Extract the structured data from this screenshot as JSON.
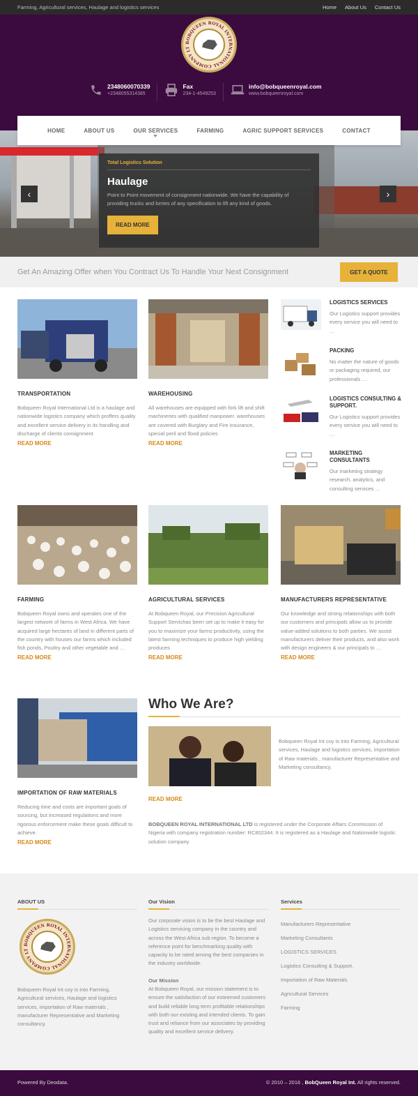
{
  "topbar": {
    "tagline": "Farming, Agricultural services, Haulage and logistics services",
    "links": [
      "Home",
      "About Us",
      "Contact Us"
    ]
  },
  "logo": {
    "ring_text": "BOBQUEEN ROYAL INTERNATIONAL COMPANY LTD"
  },
  "contacts": [
    {
      "icon": "phone-icon",
      "main": "2348060070339",
      "sub": "+2348055314385"
    },
    {
      "icon": "fax-icon",
      "main": "Fax",
      "sub": "234-1-4549253"
    },
    {
      "icon": "laptop-icon",
      "main": "info@bobqueenroyal.com",
      "sub": "www.bobqueenroyal.com"
    }
  ],
  "nav": [
    "HOME",
    "ABOUT US",
    "OUR SERVICES",
    "FARMING",
    "AGRIC SUPPORT SERVICES",
    "CONTACT"
  ],
  "slide": {
    "kicker": "Total Logistics Solution",
    "title": "Haulage",
    "text": "Point to Point movement of consignment nationwide. We have the capability of providing trucks and lorries of any specification to lift any kind of goods.",
    "button": "READ MORE"
  },
  "offer": {
    "text": "Get An Amazing Offer when You Contract Us To Handle Your Next Consignment",
    "button": "GET A QUOTE"
  },
  "services": [
    {
      "title": "TRANSPORTATION",
      "text": "Bobqueen Royal International Ltd is a haulage and nationwide logistics company which proffers quality and excellent service delivery in its handling and discharge of clients consignment",
      "link": "READ MORE"
    },
    {
      "title": "WAREHOUSING",
      "text": "All warehouses are equipped with fork lift and shift machineries with qualified manpower. warehouses are covered with Burglary and Fire insurance, special peril and flood policies",
      "link": "READ MORE"
    },
    {
      "title": "FARMING",
      "text": "Bobqueen Royal owns and operates one of the largest network of farms in West Africa. We have acquired large hectares of land in different parts of the country with houses our farms which included fish ponds, Poultry and other vegetable and …",
      "link": "READ MORE"
    },
    {
      "title": "AGRICULTURAL SERVICES",
      "text": "At Bobqueen Royal, our Precision Agricultural Support Servichas been set up to make it easy for you to maximize your farms productivity, using the latest farming techniques to produce high yielding produces",
      "link": "READ MORE"
    },
    {
      "title": "MANUFACTURERS REPRESENTATIVE",
      "text": "Our knowledge and strong relationships with both our customers and principals allow us to provide value-added solutions to both parties. We assist manufacturers deliver their products, and also work with design engineers & our principals to …",
      "link": "READ MORE"
    },
    {
      "title": "IMPORTATION OF RAW MATERIALS",
      "text": "Reducing time and costs are important goals of sourcing, but increased regulations and more rigorous enforcement make these goals difficult to achieve.",
      "link": "READ MORE"
    }
  ],
  "side_services": [
    {
      "title": "LOGISTICS SERVICES",
      "text": "Our Logistics support provides every service you will need to …"
    },
    {
      "title": "PACKING",
      "text": "No matter the nature of goods or packaging required, our professionals …"
    },
    {
      "title": "LOGISTICS CONSULTING & SUPPORT.",
      "text": "Our Logistics support provides every service you will need to …"
    },
    {
      "title": "MARKETING CONSULTANTS",
      "text": "Our marketing strategy research, analytics, and consulting services …"
    }
  ],
  "who": {
    "title": "Who We Are?",
    "text": "Bobqueen Royal Int coy is into Farming, Agricultural services, Haulage and logistics services, importation of Raw materials , manufacturer Representative and Marketing consultancy.",
    "link": "READ MORE",
    "reg_name": "BOBQUEEN ROYAL INTERNATIONAL LTD",
    "reg_text": " is registered under the Corporate Affairs Commission of Nigeria with company registration number: RC802344. It is registered as a Haulage and Nationwide logistic solution company"
  },
  "footer": {
    "about": {
      "title": "ABOUT US",
      "text": "Bobqueen Royal Int coy is into Farming, Agricultural services, Haulage and logistics services, importation of Raw materials , manufacturer Representative and Marketing consultancy."
    },
    "vision": {
      "title": "Our Vision",
      "text": "Our corporate vision is to be the best Haulage and Logistics servicing company in the country and across the West Africa sub region. To become a reference point for benchmarking quality with capacity to be rated among the best companies in the industry worldwide.",
      "mission_title": "Our Mission",
      "mission_text": "At Bobqueen Royal, our mission statement is to ensure the satisfaction of our esteemed customers and build reliable long term profitable relationships with both our existing and intended clients. To gain trust and reliance from our associates by providing quality and excellent service delivery."
    },
    "services": {
      "title": "Services",
      "links": [
        "Manufacturers Representative",
        "Marketing Consultants",
        "LOGISTICS SERVICES",
        "Logistics Consulting & Support.",
        "Importation of Raw Materials",
        "Agricultural Services",
        "Farming"
      ]
    }
  },
  "bottom": {
    "powered": "Powered By Deodata.",
    "copy_pre": "© 2010 – 2016 ,",
    "copy_name": " BobQueen Royal Int.",
    "copy_post": " All rights reserved."
  },
  "colors": {
    "header": "#3b0a3e",
    "accent": "#e6b23a",
    "link": "#d48a1a"
  }
}
